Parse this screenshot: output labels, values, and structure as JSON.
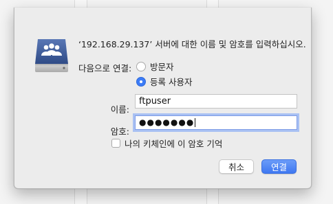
{
  "dialog": {
    "message": "‘192.168.29.137’ 서버에 대한 이름 및 암호를 입력하십시오.",
    "connect_as_label": "다음으로 연결:",
    "connect_options": [
      {
        "label": "방문자",
        "selected": false
      },
      {
        "label": "등록 사용자",
        "selected": true
      }
    ],
    "name_label": "이름:",
    "name_value": "ftpuser",
    "password_label": "암호:",
    "password_value": "●●●●●●●",
    "remember_keychain_label": "나의 키체인에 이 암호 기억",
    "remember_keychain_checked": false,
    "cancel_label": "취소",
    "connect_label": "연결"
  },
  "icons": {
    "server": "network-server-users-icon"
  },
  "colors": {
    "accent": "#3c7cf7",
    "focus_ring": "#a9c1f3",
    "icon_blue": "#3d5a96"
  }
}
